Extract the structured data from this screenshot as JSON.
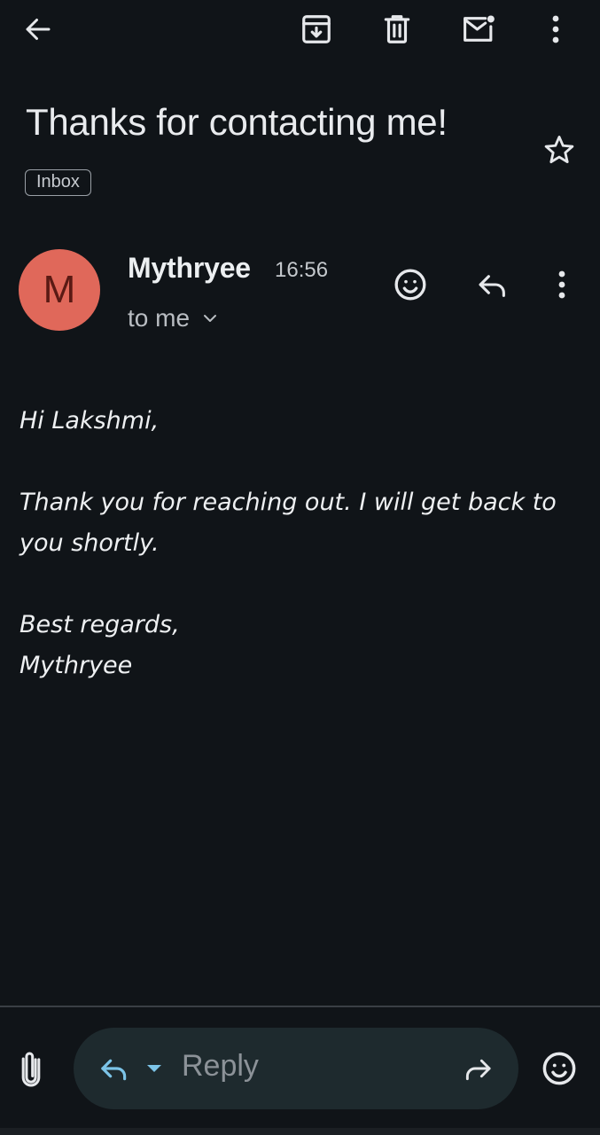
{
  "toolbar": {
    "back_icon": "arrow-left-icon",
    "archive_icon": "archive-icon",
    "delete_icon": "trash-icon",
    "mark_unread_icon": "mail-unread-icon",
    "more_icon": "more-vertical-icon"
  },
  "email": {
    "subject": "Thanks for contacting me!",
    "label": "Inbox",
    "starred": false,
    "sender": {
      "initial": "M",
      "name": "Mythryee",
      "time": "16:56",
      "avatar_color": "#e0685a"
    },
    "recipient": "to me",
    "body": {
      "greeting": "Hi Lakshmi,",
      "paragraph": "Thank you for reaching out. I will get back to you shortly.",
      "closing": "Best regards,",
      "signature": "Mythryee"
    }
  },
  "compose": {
    "reply_placeholder": "Reply",
    "attach_icon": "paperclip-icon",
    "emoji_icon": "smiley-icon",
    "forward_icon": "forward-icon",
    "reply_icon": "reply-icon"
  },
  "colors": {
    "background": "#101418",
    "accent": "#7cc4e8",
    "reply_bar": "#1e2a2e"
  }
}
